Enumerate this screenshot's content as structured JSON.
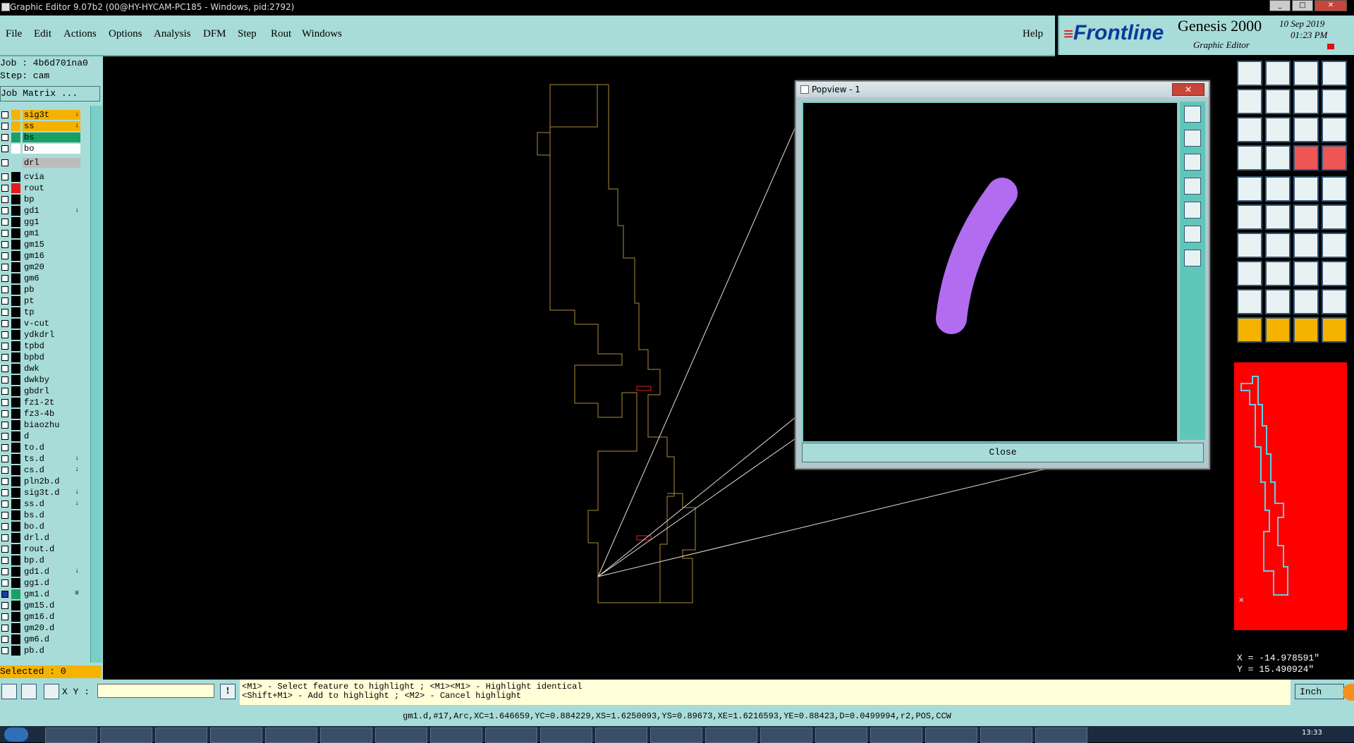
{
  "titlebar": {
    "title": "Graphic Editor 9.07b2 (00@HY-HYCAM-PC185 - Windows, pid:2792)"
  },
  "menu": [
    "File",
    "Edit",
    "Actions",
    "Options",
    "Analysis",
    "DFM",
    "Step",
    "Rout",
    "Windows"
  ],
  "help_label": "Help",
  "brand": {
    "logo": "Frontline",
    "product": "Genesis 2000",
    "module": "Graphic Editor",
    "date": "10 Sep 2019",
    "time": "01:23 PM"
  },
  "job": {
    "job_label": "Job : 4b6d701na0",
    "step_label": "Step: cam",
    "matrix_button": "Job Matrix ..."
  },
  "layers": [
    {
      "name": "sig3t",
      "color": "#f5b300",
      "bg": "#f5b300",
      "mark": "↓"
    },
    {
      "name": "ss",
      "color": "#f5b300",
      "bg": "#f5b300",
      "mark": "↓"
    },
    {
      "name": "bs",
      "color": "#1aa066",
      "bg": "#1aa066",
      "mark": ""
    },
    {
      "name": "bo",
      "color": "#ffffff",
      "bg": "#ffffff",
      "mark": ""
    },
    {
      "name": "drl",
      "color": "#a8dcd8",
      "bg": "#bcbcbc",
      "mark": ""
    },
    {
      "name": "cvia",
      "color": "",
      "bg": "",
      "mark": ""
    },
    {
      "name": "rout",
      "color": "#e31b1b",
      "bg": "",
      "mark": ""
    },
    {
      "name": "bp",
      "color": "",
      "bg": "",
      "mark": ""
    },
    {
      "name": "gd1",
      "color": "",
      "bg": "",
      "mark": "↓"
    },
    {
      "name": "gg1",
      "color": "",
      "bg": "",
      "mark": ""
    },
    {
      "name": "gm1",
      "color": "",
      "bg": "",
      "mark": ""
    },
    {
      "name": "gm15",
      "color": "",
      "bg": "",
      "mark": ""
    },
    {
      "name": "gm16",
      "color": "",
      "bg": "",
      "mark": ""
    },
    {
      "name": "gm20",
      "color": "",
      "bg": "",
      "mark": ""
    },
    {
      "name": "gm6",
      "color": "",
      "bg": "",
      "mark": ""
    },
    {
      "name": "pb",
      "color": "",
      "bg": "",
      "mark": ""
    },
    {
      "name": "pt",
      "color": "",
      "bg": "",
      "mark": ""
    },
    {
      "name": "tp",
      "color": "",
      "bg": "",
      "mark": ""
    },
    {
      "name": "v-cut",
      "color": "",
      "bg": "",
      "mark": ""
    },
    {
      "name": "ydkdrl",
      "color": "",
      "bg": "",
      "mark": ""
    },
    {
      "name": "tpbd",
      "color": "",
      "bg": "",
      "mark": ""
    },
    {
      "name": "bpbd",
      "color": "",
      "bg": "",
      "mark": ""
    },
    {
      "name": "dwk",
      "color": "",
      "bg": "",
      "mark": ""
    },
    {
      "name": "dwkby",
      "color": "",
      "bg": "",
      "mark": ""
    },
    {
      "name": "gbdrl",
      "color": "",
      "bg": "",
      "mark": ""
    },
    {
      "name": "fz1-2t",
      "color": "",
      "bg": "",
      "mark": ""
    },
    {
      "name": "fz3-4b",
      "color": "",
      "bg": "",
      "mark": ""
    },
    {
      "name": "biaozhu",
      "color": "",
      "bg": "",
      "mark": ""
    },
    {
      "name": "d",
      "color": "",
      "bg": "",
      "mark": ""
    },
    {
      "name": "to.d",
      "color": "",
      "bg": "",
      "mark": ""
    },
    {
      "name": "ts.d",
      "color": "",
      "bg": "",
      "mark": "↓"
    },
    {
      "name": "cs.d",
      "color": "",
      "bg": "",
      "mark": "↓"
    },
    {
      "name": "pln2b.d",
      "color": "",
      "bg": "",
      "mark": ""
    },
    {
      "name": "sig3t.d",
      "color": "",
      "bg": "",
      "mark": "↓"
    },
    {
      "name": "ss.d",
      "color": "",
      "bg": "",
      "mark": "↓"
    },
    {
      "name": "bs.d",
      "color": "",
      "bg": "",
      "mark": ""
    },
    {
      "name": "bo.d",
      "color": "",
      "bg": "",
      "mark": ""
    },
    {
      "name": "drl.d",
      "color": "",
      "bg": "",
      "mark": ""
    },
    {
      "name": "rout.d",
      "color": "",
      "bg": "",
      "mark": ""
    },
    {
      "name": "bp.d",
      "color": "",
      "bg": "",
      "mark": ""
    },
    {
      "name": "gd1.d",
      "color": "",
      "bg": "",
      "mark": "↓"
    },
    {
      "name": "gg1.d",
      "color": "",
      "bg": "",
      "mark": ""
    },
    {
      "name": "gm1.d",
      "color": "#1aa066",
      "bg": "",
      "mark": "≡",
      "checked": true
    },
    {
      "name": "gm15.d",
      "color": "",
      "bg": "",
      "mark": ""
    },
    {
      "name": "gm16.d",
      "color": "",
      "bg": "",
      "mark": ""
    },
    {
      "name": "gm20.d",
      "color": "",
      "bg": "",
      "mark": ""
    },
    {
      "name": "gm6.d",
      "color": "",
      "bg": "",
      "mark": ""
    },
    {
      "name": "pb.d",
      "color": "",
      "bg": "",
      "mark": ""
    }
  ],
  "selected_label": "Selected : 0",
  "xy_label": "X Y :",
  "xy_value": "",
  "message": {
    "line1": "<M1> - Select feature to highlight ; <M1><M1> - Highlight identical",
    "line2": "<Shift+M1> - Add to highlight ; <M2> - Cancel highlight"
  },
  "units": "Inch",
  "status_line": "gm1.d,#17,Arc,XC=1.646659,YC=0.884229,XS=1.6250093,YS=0.89673,XE=1.6216593,YE=0.88423,D=0.0499994,r2,POS,CCW",
  "popview": {
    "title": "Popview - 1",
    "close_label": "Close"
  },
  "coords": {
    "x": "X = -14.978591\"",
    "y": "Y =  15.490924\""
  },
  "taskbar_clock": "13:33",
  "colors": {
    "panel": "#a8dcd8",
    "outline": "#b08a3a",
    "feature": "#b16cf0",
    "overview": "#ff0000"
  }
}
